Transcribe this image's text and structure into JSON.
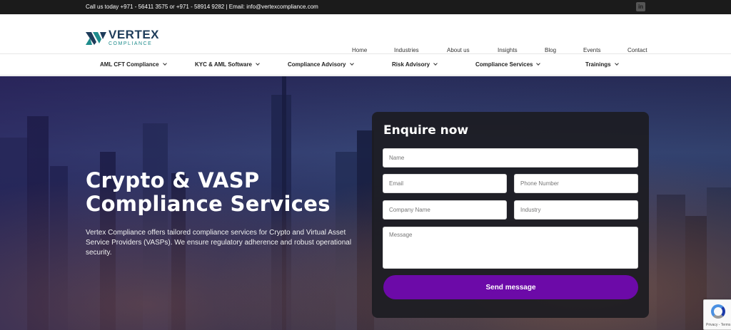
{
  "topbar": {
    "contact_text": "Call us today +971 - 56411 3575 or +971 - 58914 9282 | Email: info@vertexcompliance.com",
    "social_icon": "linkedin-icon"
  },
  "brand": {
    "name": "VERTEX",
    "tagline": "COMPLIANCE",
    "colors": {
      "navy": "#1e3c5a",
      "teal": "#1e8c8c",
      "accent": "#6c0aa8"
    }
  },
  "main_nav": [
    "Home",
    "Industries",
    "About us",
    "Insights",
    "Blog",
    "Events",
    "Contact"
  ],
  "sub_nav": [
    "AML CFT Compliance",
    "KYC & AML Software",
    "Compliance Advisory",
    "Risk Advisory",
    "Compliance Services",
    "Trainings"
  ],
  "hero": {
    "title_line1": "Crypto & VASP",
    "title_line2": "Compliance Services",
    "description": "Vertex Compliance offers tailored compliance services for Crypto and Virtual Asset Service Providers (VASPs). We ensure regulatory adherence and robust operational security."
  },
  "form": {
    "title": "Enquire now",
    "name_placeholder": "Name",
    "email_placeholder": "Email",
    "phone_placeholder": "Phone Number",
    "company_placeholder": "Company Name",
    "industry_placeholder": "Industry",
    "message_placeholder": "Message",
    "submit_label": "Send message"
  },
  "recaptcha": {
    "footer_text": "Privacy - Terms"
  }
}
